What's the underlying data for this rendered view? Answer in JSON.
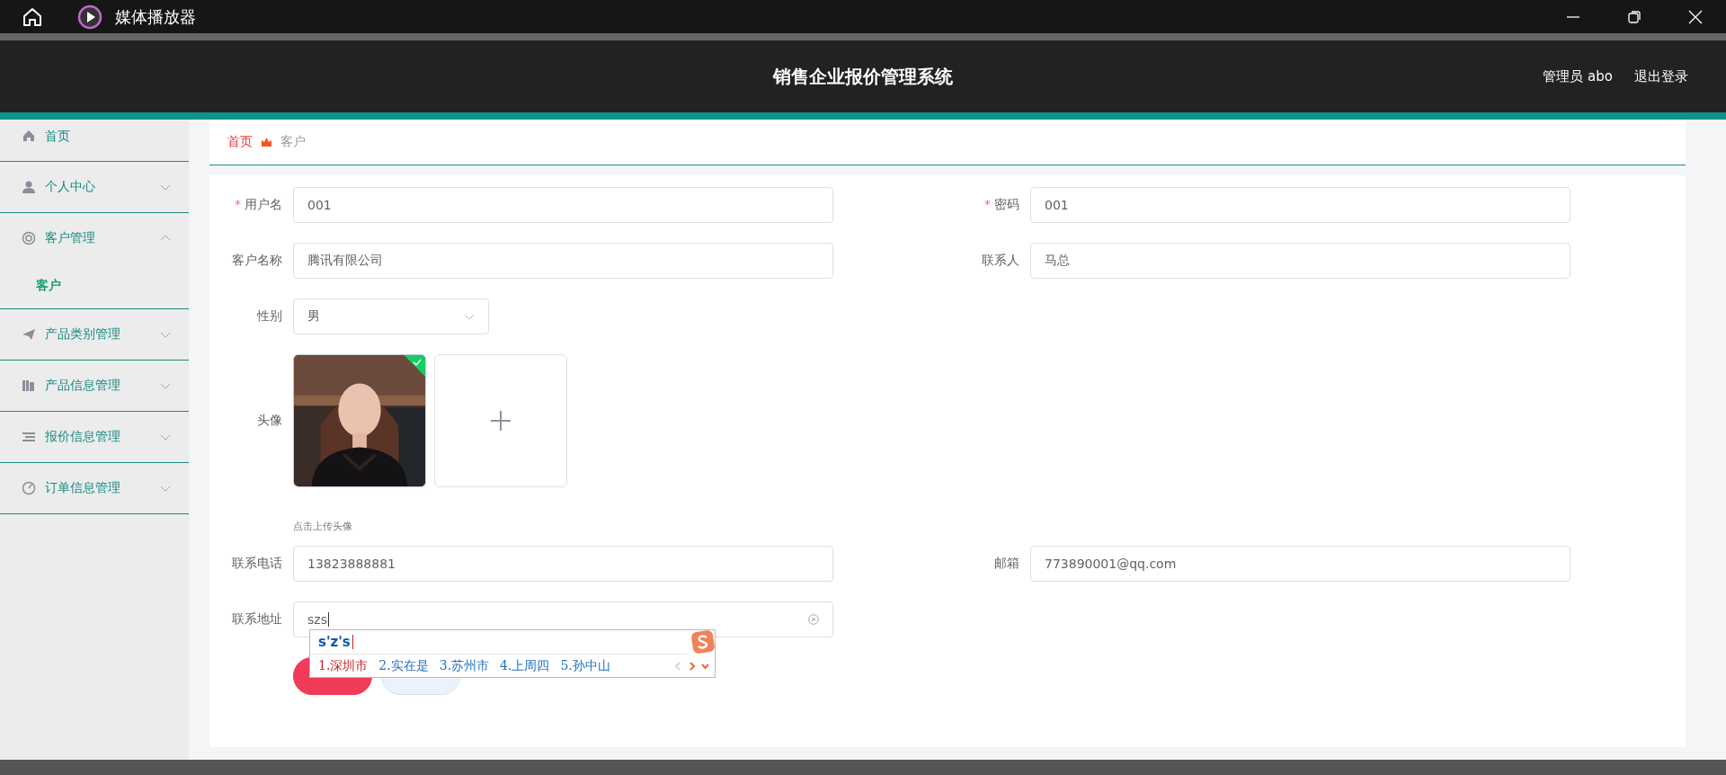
{
  "titlebar": {
    "title": "媒体播放器"
  },
  "header": {
    "title": "销售企业报价管理系统",
    "user": "管理员 abo",
    "logout": "退出登录"
  },
  "sidebar": {
    "items": [
      {
        "label": "首页"
      },
      {
        "label": "个人中心",
        "expanded": false
      },
      {
        "label": "客户管理",
        "expanded": true,
        "children": [
          {
            "label": "客户",
            "selected": true
          }
        ]
      },
      {
        "label": "产品类别管理",
        "expanded": false
      },
      {
        "label": "产品信息管理",
        "expanded": false
      },
      {
        "label": "报价信息管理",
        "expanded": false
      },
      {
        "label": "订单信息管理",
        "expanded": false
      }
    ]
  },
  "breadcrumb": [
    {
      "label": "首页",
      "kind": "link"
    },
    {
      "label": "客户",
      "kind": "current"
    }
  ],
  "form": {
    "rows": [
      [
        {
          "label": "用户名",
          "kind": "input",
          "marker": "*",
          "value": "001"
        },
        {
          "label": "密码",
          "kind": "input",
          "marker": "*",
          "value": "001"
        }
      ],
      [
        {
          "label": "客户名称",
          "kind": "input",
          "value": "腾讯有限公司"
        },
        {
          "label": "联系人",
          "kind": "input",
          "value": "马总"
        }
      ],
      [
        {
          "label": "性别",
          "kind": "select",
          "value": "男"
        }
      ],
      [
        {
          "label": "头像",
          "kind": "upload",
          "uploaded": true,
          "hint": "点击上传头像"
        }
      ],
      [
        {
          "label": "联系电话",
          "kind": "input",
          "value": "13823888881"
        },
        {
          "label": "邮箱",
          "kind": "input",
          "value": "773890001@qq.com"
        }
      ],
      [
        {
          "label": "联系地址",
          "kind": "input",
          "value": "szs",
          "clearable": true,
          "ime": {
            "composition": "s'z's",
            "candidates": [
              {
                "label": "1.深圳市",
                "selected": true
              },
              {
                "label": "2.实在是",
                "selected": false
              },
              {
                "label": "3.苏州市",
                "selected": false
              },
              {
                "label": "4.上周四",
                "selected": false
              },
              {
                "label": "5.孙中山",
                "selected": false
              }
            ]
          }
        }
      ]
    ],
    "buttons": [
      {
        "kind": "primary"
      },
      {
        "kind": "secondary"
      }
    ]
  }
}
